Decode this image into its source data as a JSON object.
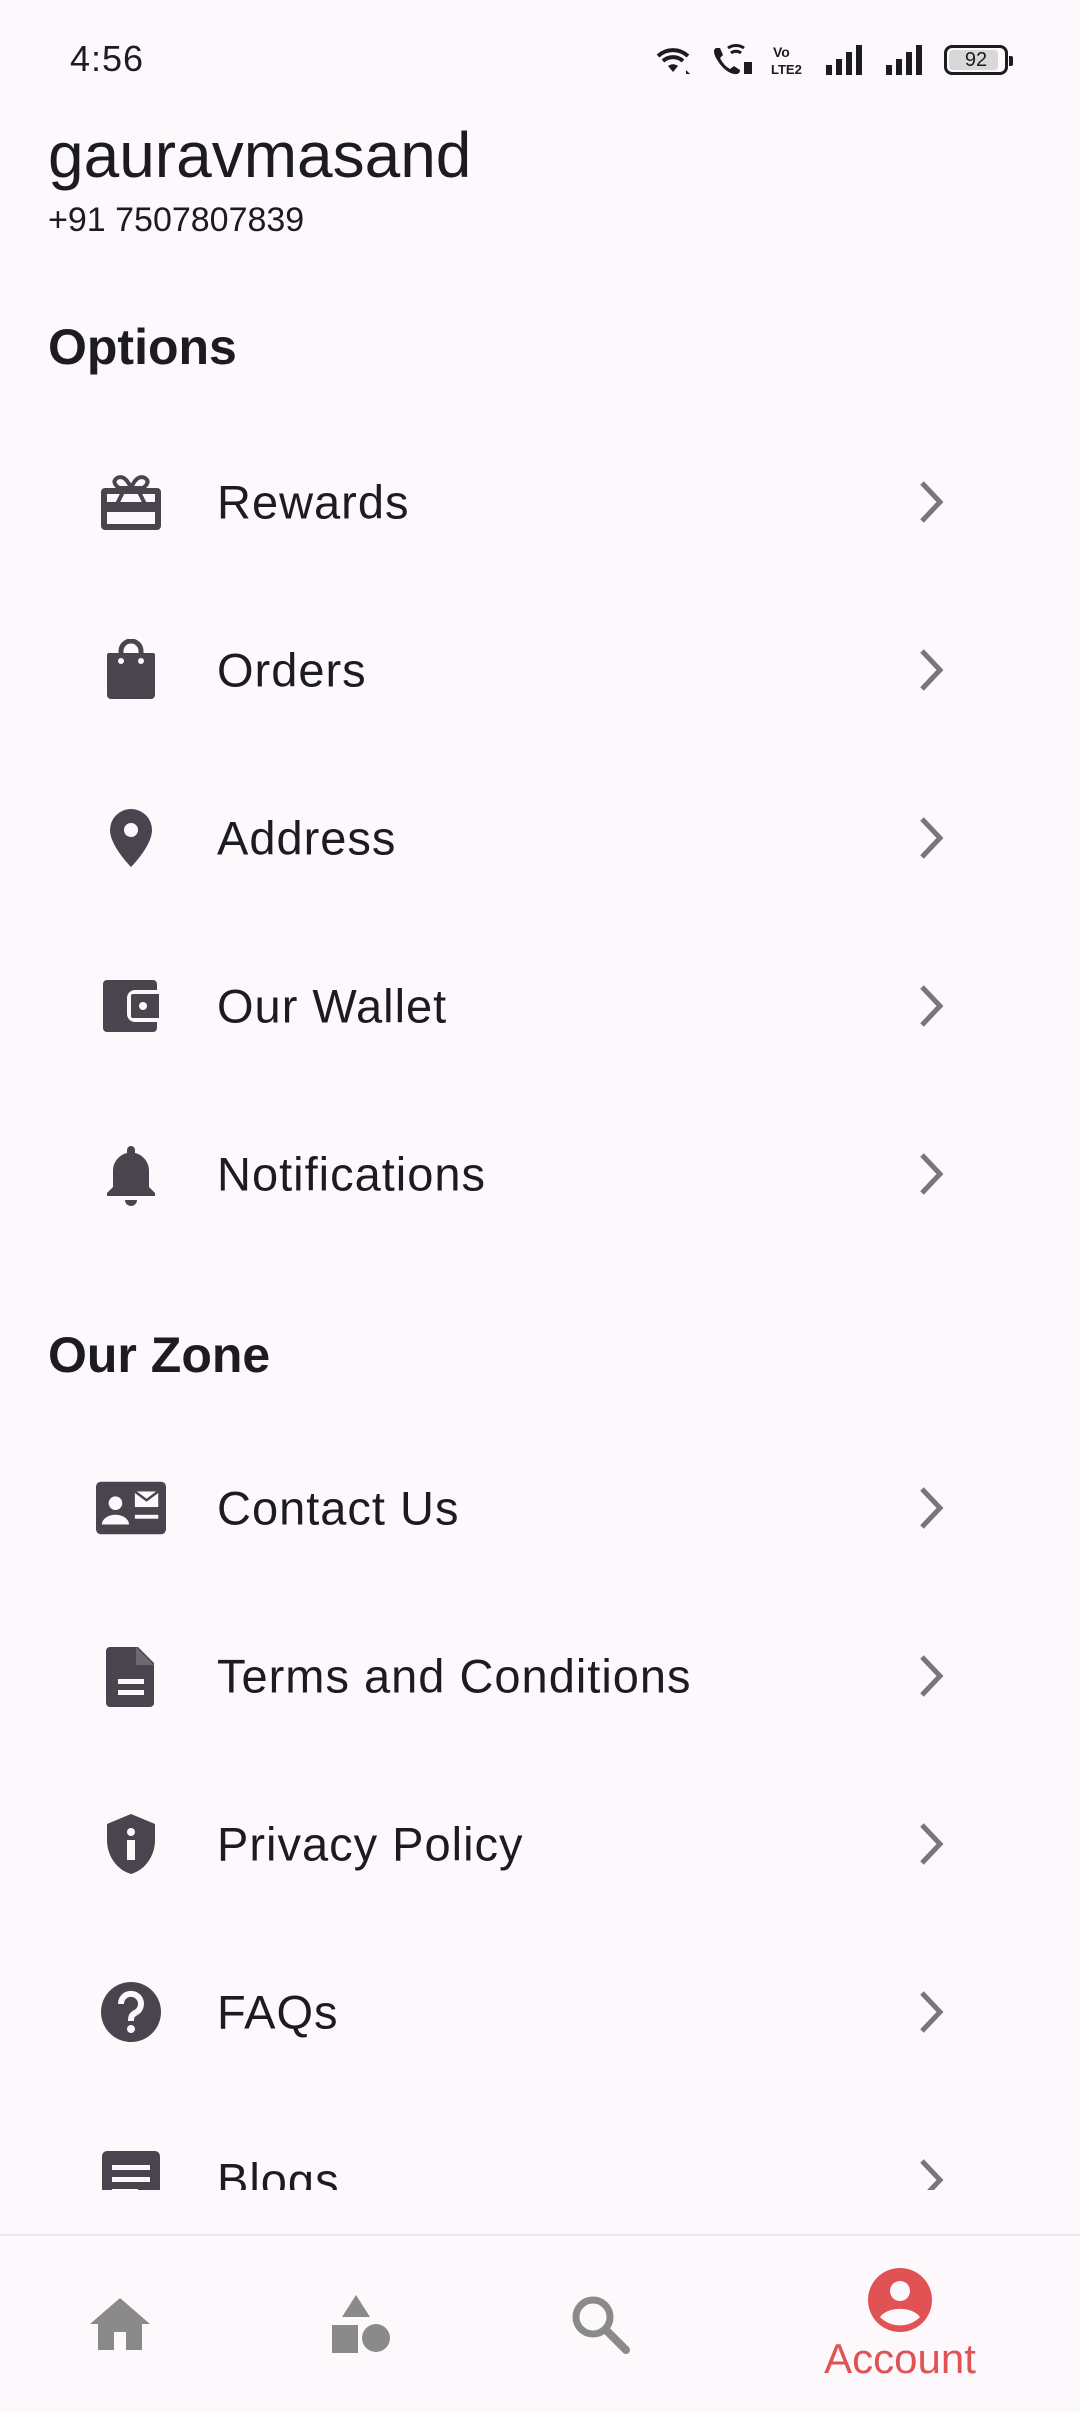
{
  "status_bar": {
    "time": "4:56",
    "battery": "92",
    "battery_level": 0.92
  },
  "profile": {
    "name": "gauravmasand",
    "phone": "+91 7507807839"
  },
  "sections": {
    "options_title": "Options",
    "zone_title": "Our Zone"
  },
  "options": [
    {
      "label": "Rewards",
      "icon": "card-giftcard-icon"
    },
    {
      "label": "Orders",
      "icon": "shopping-bag-icon"
    },
    {
      "label": "Address",
      "icon": "location-pin-icon"
    },
    {
      "label": "Our Wallet",
      "icon": "wallet-icon"
    },
    {
      "label": "Notifications",
      "icon": "bell-icon"
    }
  ],
  "zone": [
    {
      "label": "Contact Us",
      "icon": "contact-mail-icon"
    },
    {
      "label": "Terms and Conditions",
      "icon": "document-icon"
    },
    {
      "label": "Privacy Policy",
      "icon": "shield-info-icon"
    },
    {
      "label": "FAQs",
      "icon": "help-circle-icon"
    },
    {
      "label": "Blogs",
      "icon": "article-icon"
    }
  ],
  "bottom_nav": {
    "items": [
      {
        "icon": "home-icon",
        "label": ""
      },
      {
        "icon": "categories-icon",
        "label": ""
      },
      {
        "icon": "search-icon",
        "label": ""
      },
      {
        "icon": "account-circle-icon",
        "label": "Account"
      }
    ],
    "active_color": "#e05253",
    "inactive_color": "#8a8a8a"
  },
  "colors": {
    "background": "#fdf8fb",
    "icon": "#49454f",
    "chevron": "#79747e",
    "accent": "#e05253"
  }
}
